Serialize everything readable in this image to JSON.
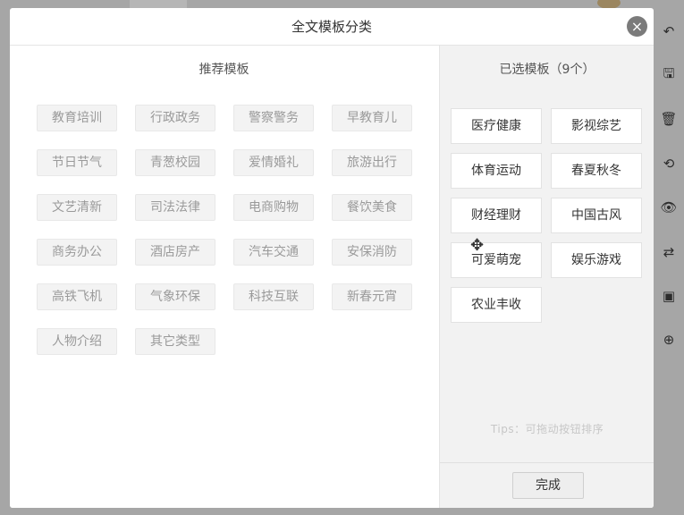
{
  "modal": {
    "title": "全文模板分类",
    "close_icon": "×"
  },
  "recommended": {
    "title": "推荐模板",
    "items": [
      "教育培训",
      "行政政务",
      "警察警务",
      "早教育儿",
      "节日节气",
      "青葱校园",
      "爱情婚礼",
      "旅游出行",
      "文艺清新",
      "司法法律",
      "电商购物",
      "餐饮美食",
      "商务办公",
      "酒店房产",
      "汽车交通",
      "安保消防",
      "高铁飞机",
      "气象环保",
      "科技互联",
      "新春元宵",
      "人物介绍",
      "其它类型"
    ]
  },
  "selected": {
    "title": "已选模板（9个）",
    "items": [
      "医疗健康",
      "影视综艺",
      "体育运动",
      "春夏秋冬",
      "财经理财",
      "中国古风",
      "可爱萌宠",
      "娱乐游戏",
      "农业丰收"
    ],
    "tips": "Tips：可拖动按钮排序",
    "done_label": "完成"
  },
  "toolbar": {
    "icons": [
      "undo-icon",
      "save-icon",
      "delete-icon",
      "history-icon",
      "preview-icon",
      "swap-icon",
      "image-icon",
      "zoom-icon"
    ],
    "glyphs": [
      "↶",
      "🖫",
      "🗑",
      "⟲",
      "👁",
      "⇄",
      "▣",
      "⊕"
    ]
  },
  "colors": {
    "overlay": "#a6a6a6",
    "rec_item_bg": "#f3f3f3",
    "rec_item_text": "#9a9a9a",
    "right_panel_bg": "#f2f2f2",
    "close_bg": "#7b7b7b"
  }
}
